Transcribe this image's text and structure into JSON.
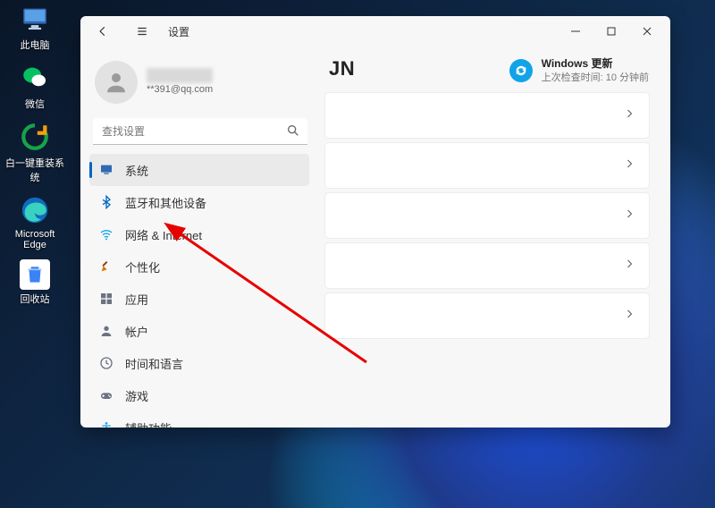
{
  "desktop_icons": [
    {
      "label": "此电脑",
      "icon": "pc"
    },
    {
      "label": "微信",
      "icon": "wechat"
    },
    {
      "label": "白一键重装系统",
      "icon": "reinstall"
    },
    {
      "label": "Microsoft Edge",
      "icon": "edge"
    },
    {
      "label": "回收站",
      "icon": "recycle"
    }
  ],
  "titlebar": {
    "app": "设置"
  },
  "account": {
    "name_masked": "████",
    "email": "**391@qq.com"
  },
  "search": {
    "placeholder": "查找设置"
  },
  "nav": [
    {
      "label": "系统",
      "icon": "system",
      "active": true
    },
    {
      "label": "蓝牙和其他设备",
      "icon": "bluetooth"
    },
    {
      "label": "网络 & Internet",
      "icon": "wifi"
    },
    {
      "label": "个性化",
      "icon": "personalize"
    },
    {
      "label": "应用",
      "icon": "apps"
    },
    {
      "label": "帐户",
      "icon": "account"
    },
    {
      "label": "时间和语言",
      "icon": "time"
    },
    {
      "label": "游戏",
      "icon": "gaming"
    },
    {
      "label": "辅助功能",
      "icon": "accessibility"
    }
  ],
  "page": {
    "title": "JN"
  },
  "windows_update": {
    "title": "Windows 更新",
    "subtitle": "上次检查时间: 10 分钟前"
  },
  "row_count": 5,
  "arrow_target": "nav.2"
}
